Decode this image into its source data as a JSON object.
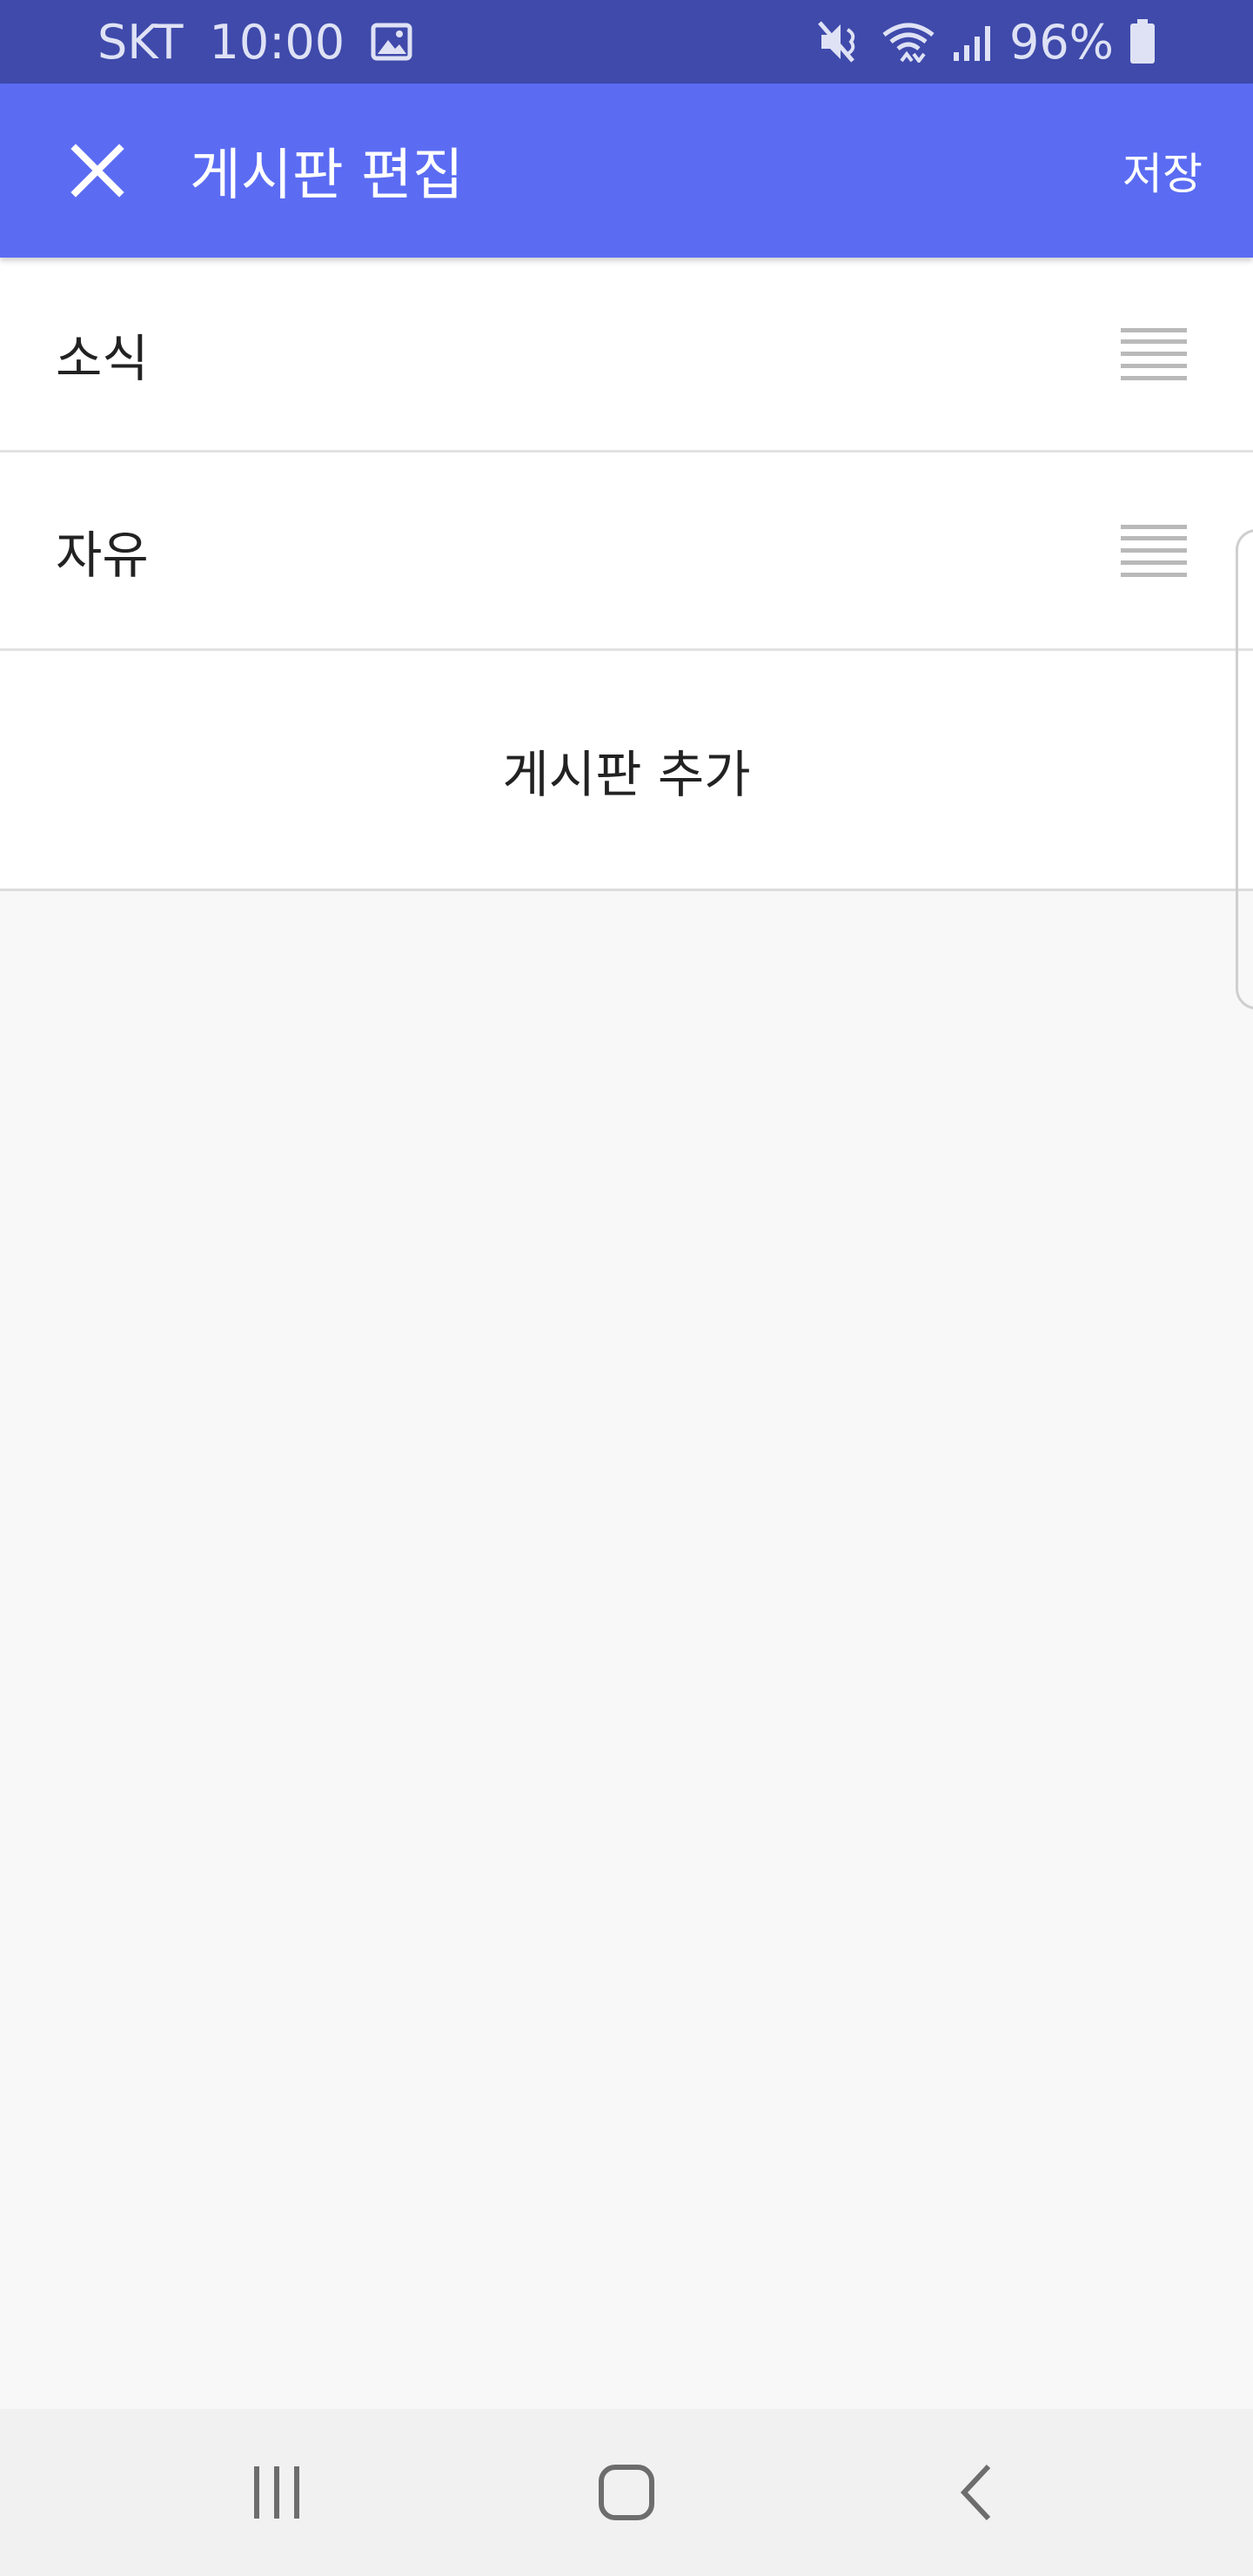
{
  "status_bar": {
    "carrier": "SKT",
    "time": "10:00",
    "battery": "96%"
  },
  "app_bar": {
    "title": "게시판 편집",
    "save_label": "저장"
  },
  "boards": [
    {
      "label": "소식"
    },
    {
      "label": "자유"
    }
  ],
  "add_board_label": "게시판 추가",
  "icons": {
    "close": "close-icon",
    "drag": "drag-handle-icon",
    "recents": "recents-icon",
    "home": "home-icon",
    "back": "back-icon"
  },
  "colors": {
    "status_bar": "#3f4aab",
    "app_bar": "#5b6cf3",
    "background": "#f8f8f8",
    "list_background": "#ffffff"
  }
}
